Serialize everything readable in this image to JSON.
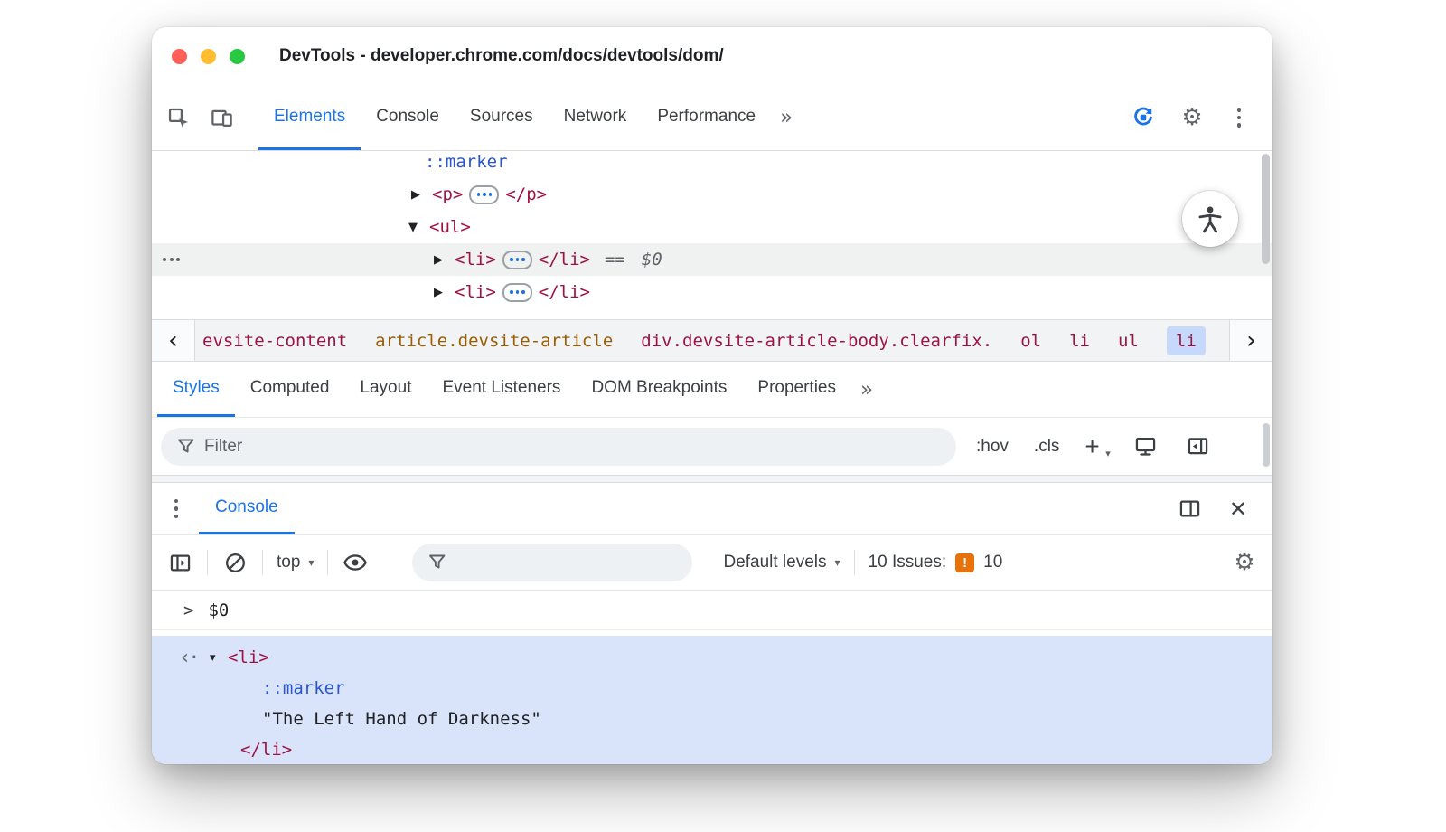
{
  "colors": {
    "accent": "#1a73e8",
    "tag": "#a01242",
    "attr_orange": "#9d5d00",
    "pseudo": "#2a56cf",
    "sel_bg": "#d9e4fb",
    "crumb_sel_bg": "#c7d9fb",
    "row_sel_bg": "#f0f1f1",
    "issues_orange": "#e8710a",
    "tl_red": "#ff5f57",
    "tl_yellow": "#febc2e",
    "tl_green": "#28c840"
  },
  "icons": {
    "gear": "⚙",
    "close": "✕",
    "overflow_chevrons": "»",
    "caret_down": "▾",
    "tri_right": "▶",
    "tri_down": "▼",
    "tri_down_small": "▾",
    "prompt_chevron": ">",
    "return_marker": "‹·",
    "crumb_left": "‹",
    "crumb_right": "›"
  },
  "window": {
    "title": "DevTools - developer.chrome.com/docs/devtools/dom/"
  },
  "toolbar": {
    "tabs": [
      "Elements",
      "Console",
      "Sources",
      "Network",
      "Performance"
    ]
  },
  "elements": {
    "marker": "::marker",
    "p_open": "<p>",
    "p_close": "</p>",
    "ul_open": "<ul>",
    "li_open": "<li>",
    "li_close": "</li>",
    "eq": "==",
    "dollar": "$0"
  },
  "breadcrumb": {
    "items": [
      {
        "label": "evsite-content"
      },
      {
        "label": "article.devsite-article"
      },
      {
        "label": "div.devsite-article-body.clearfix."
      },
      {
        "label": "ol"
      },
      {
        "label": "li"
      },
      {
        "label": "ul"
      },
      {
        "label": "li",
        "selected": true
      }
    ]
  },
  "styles_panel": {
    "tabs": [
      "Styles",
      "Computed",
      "Layout",
      "Event Listeners",
      "DOM Breakpoints",
      "Properties"
    ],
    "filter_placeholder": "Filter",
    "hov": ":hov",
    "cls": ".cls",
    "plus": "+"
  },
  "console_drawer": {
    "tab": "Console",
    "context": "top",
    "levels": "Default levels",
    "issues_label": "10 Issues:",
    "issues_badge": "!",
    "issues_count": "10",
    "command": "$0",
    "result": {
      "li_open": "<li>",
      "marker": "::marker",
      "text": "\"The Left Hand of Darkness\"",
      "li_close": "</li>"
    }
  }
}
